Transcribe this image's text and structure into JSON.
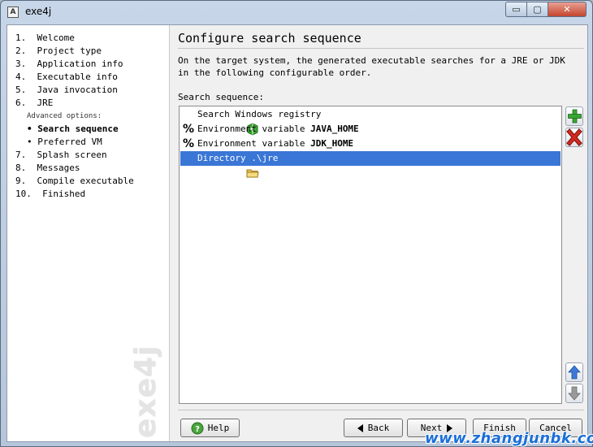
{
  "window": {
    "title": "exe4j",
    "app_icon_glyph": "A"
  },
  "window_controls": {
    "minimize": "▭",
    "maximize": "▢",
    "close": "✕"
  },
  "sidebar": {
    "steps": [
      {
        "label": "1.  Welcome"
      },
      {
        "label": "2.  Project type"
      },
      {
        "label": "3.  Application info"
      },
      {
        "label": "4.  Executable info"
      },
      {
        "label": "5.  Java invocation"
      },
      {
        "label": "6.  JRE"
      },
      {
        "label": "Advanced options:"
      },
      {
        "label": "• Search sequence"
      },
      {
        "label": "• Preferred VM"
      },
      {
        "label": "7.  Splash screen"
      },
      {
        "label": "8.  Messages"
      },
      {
        "label": "9.  Compile executable"
      },
      {
        "label": "10.  Finished"
      }
    ],
    "logo": "exe4j"
  },
  "main": {
    "heading": "Configure search sequence",
    "description": "On the target system, the generated executable searches for a JRE or JDK in the following configurable order.",
    "list_label": "Search sequence:",
    "entries": [
      {
        "prefix": "Search Windows registry",
        "bold": "",
        "icon": "registry-icon"
      },
      {
        "prefix": "Environment variable ",
        "bold": "JAVA_HOME",
        "icon": "percent-icon"
      },
      {
        "prefix": "Environment variable ",
        "bold": "JDK_HOME",
        "icon": "percent-icon"
      },
      {
        "prefix": "Directory .\\jre",
        "bold": "",
        "icon": "folder-icon"
      }
    ],
    "selected_index": 3,
    "percent_glyph": "%"
  },
  "buttons": {
    "help": "Help",
    "back": "Back",
    "next": "Next",
    "finish": "Finish",
    "cancel": "Cancel"
  },
  "watermark": "www.zhangjunbk.com",
  "colors": {
    "selection": "#3a76d6",
    "add_green": "#3aa632",
    "remove_red": "#d2281e",
    "arrow_blue": "#3d7ad6"
  }
}
